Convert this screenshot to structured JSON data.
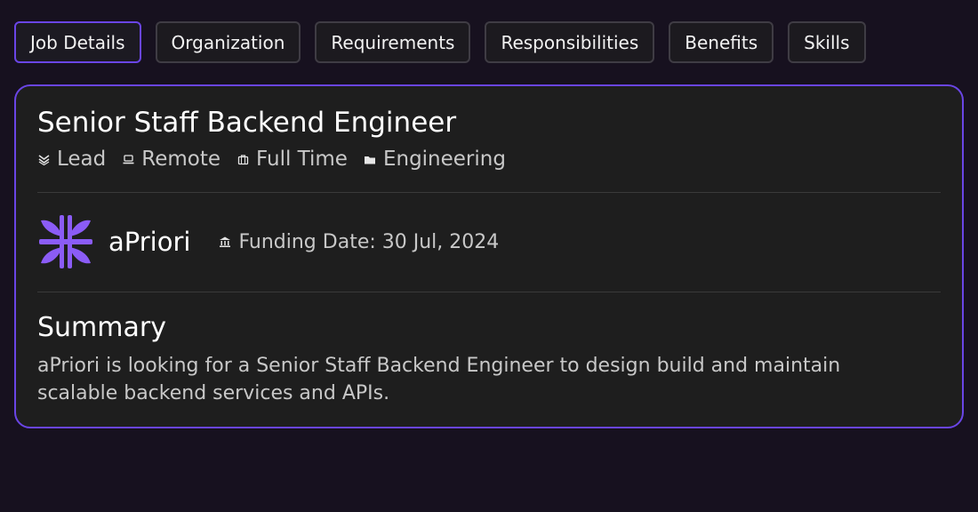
{
  "tabs": [
    {
      "label": "Job Details"
    },
    {
      "label": "Organization"
    },
    {
      "label": "Requirements"
    },
    {
      "label": "Responsibilities"
    },
    {
      "label": "Benefits"
    },
    {
      "label": "Skills"
    }
  ],
  "active_tab": "Job Details",
  "job": {
    "title": "Senior Staff Backend Engineer",
    "meta": [
      {
        "icon": "chevrons-icon",
        "label": "Lead"
      },
      {
        "icon": "laptop-icon",
        "label": "Remote"
      },
      {
        "icon": "briefcase-icon",
        "label": "Full Time"
      },
      {
        "icon": "folder-icon",
        "label": "Engineering"
      }
    ]
  },
  "company": {
    "name": "aPriori",
    "funding_icon": "bank-icon",
    "funding_label": "Funding Date: 30 Jul, 2024",
    "logo_color": "#8b5cf6"
  },
  "summary": {
    "title": "Summary",
    "text": "aPriori is looking for a Senior Staff Backend Engineer to design build and maintain scalable backend services and APIs."
  },
  "colors": {
    "accent": "#6a45e6",
    "background": "#17111f",
    "card": "#1e1e1e"
  }
}
